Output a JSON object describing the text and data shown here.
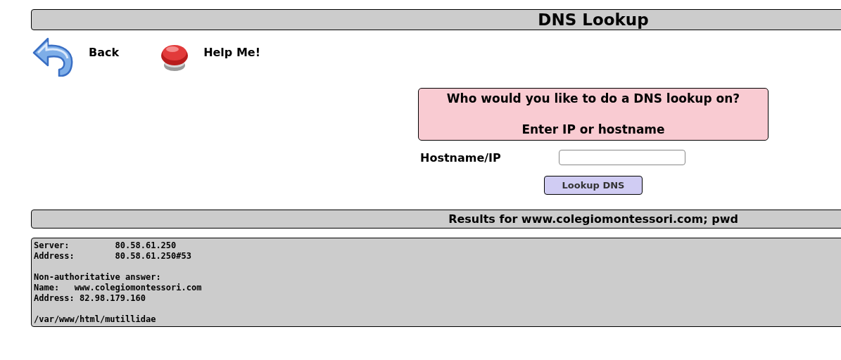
{
  "page_title": "DNS Lookup",
  "nav": [
    {
      "kind": "back",
      "label": "Back"
    },
    {
      "kind": "help",
      "label": "Help Me!"
    }
  ],
  "form": {
    "prompt_lines": [
      "Who would you like to do a DNS lookup on?",
      "Enter IP or hostname"
    ],
    "field_label": "Hostname/IP",
    "button": "Lookup DNS"
  },
  "results": {
    "title": "Results for www.colegiomontessori.com; pwd",
    "blocks": [
      [
        "Server:\t\t80.58.61.250",
        "Address:\t80.58.61.250#53"
      ],
      [
        "Non-authoritative answer:",
        "Name:\twww.colegiomontessori.com",
        "Address: 82.98.179.160"
      ],
      [
        "/var/www/html/mutillidae"
      ]
    ]
  }
}
